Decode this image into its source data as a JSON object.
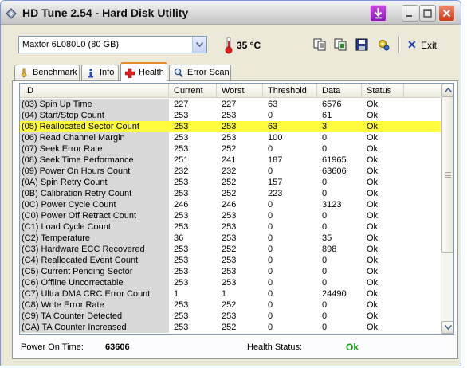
{
  "window": {
    "title": "HD Tune 2.54 - Hard Disk Utility",
    "icons": {
      "app": "hd-tune-icon",
      "download": "download-arrow-icon",
      "minimize": "minimize-icon",
      "maximize": "maximize-icon",
      "close": "close-icon"
    }
  },
  "toolbar": {
    "drive": "Maxtor 6L080L0 (80 GB)",
    "temperature": "35 °C",
    "exit_symbol": "✕",
    "exit_label": "Exit",
    "icons": [
      "copy-text-icon",
      "copy-screen-icon",
      "save-icon",
      "options-icon"
    ]
  },
  "tabs": [
    {
      "label": "Benchmark",
      "icon": "benchmark-icon",
      "active": false
    },
    {
      "label": "Info",
      "icon": "info-icon",
      "active": false
    },
    {
      "label": "Health",
      "icon": "health-cross-icon",
      "active": true
    },
    {
      "label": "Error Scan",
      "icon": "magnifier-icon",
      "active": false
    }
  ],
  "health": {
    "columns": [
      "ID",
      "Current",
      "Worst",
      "Threshold",
      "Data",
      "Status"
    ],
    "rows": [
      {
        "id": "(03) Spin Up Time",
        "current": "227",
        "worst": "227",
        "threshold": "63",
        "data": "6576",
        "status": "Ok",
        "highlight": false
      },
      {
        "id": "(04) Start/Stop Count",
        "current": "253",
        "worst": "253",
        "threshold": "0",
        "data": "61",
        "status": "Ok",
        "highlight": false
      },
      {
        "id": "(05) Reallocated Sector Count",
        "current": "253",
        "worst": "253",
        "threshold": "63",
        "data": "3",
        "status": "Ok",
        "highlight": true
      },
      {
        "id": "(06) Read Channel Margin",
        "current": "253",
        "worst": "253",
        "threshold": "100",
        "data": "0",
        "status": "Ok",
        "highlight": false
      },
      {
        "id": "(07) Seek Error Rate",
        "current": "253",
        "worst": "252",
        "threshold": "0",
        "data": "0",
        "status": "Ok",
        "highlight": false
      },
      {
        "id": "(08) Seek Time Performance",
        "current": "251",
        "worst": "241",
        "threshold": "187",
        "data": "61965",
        "status": "Ok",
        "highlight": false
      },
      {
        "id": "(09) Power On Hours Count",
        "current": "232",
        "worst": "232",
        "threshold": "0",
        "data": "63606",
        "status": "Ok",
        "highlight": false
      },
      {
        "id": "(0A) Spin Retry Count",
        "current": "253",
        "worst": "252",
        "threshold": "157",
        "data": "0",
        "status": "Ok",
        "highlight": false
      },
      {
        "id": "(0B) Calibration Retry Count",
        "current": "253",
        "worst": "252",
        "threshold": "223",
        "data": "0",
        "status": "Ok",
        "highlight": false
      },
      {
        "id": "(0C) Power Cycle Count",
        "current": "246",
        "worst": "246",
        "threshold": "0",
        "data": "3123",
        "status": "Ok",
        "highlight": false
      },
      {
        "id": "(C0) Power Off Retract Count",
        "current": "253",
        "worst": "253",
        "threshold": "0",
        "data": "0",
        "status": "Ok",
        "highlight": false
      },
      {
        "id": "(C1) Load Cycle Count",
        "current": "253",
        "worst": "253",
        "threshold": "0",
        "data": "0",
        "status": "Ok",
        "highlight": false
      },
      {
        "id": "(C2) Temperature",
        "current": "36",
        "worst": "253",
        "threshold": "0",
        "data": "35",
        "status": "Ok",
        "highlight": false
      },
      {
        "id": "(C3) Hardware ECC Recovered",
        "current": "253",
        "worst": "252",
        "threshold": "0",
        "data": "898",
        "status": "Ok",
        "highlight": false
      },
      {
        "id": "(C4) Reallocated Event Count",
        "current": "253",
        "worst": "253",
        "threshold": "0",
        "data": "0",
        "status": "Ok",
        "highlight": false
      },
      {
        "id": "(C5) Current Pending Sector",
        "current": "253",
        "worst": "253",
        "threshold": "0",
        "data": "0",
        "status": "Ok",
        "highlight": false
      },
      {
        "id": "(C6) Offline Uncorrectable",
        "current": "253",
        "worst": "253",
        "threshold": "0",
        "data": "0",
        "status": "Ok",
        "highlight": false
      },
      {
        "id": "(C7) Ultra DMA CRC Error Count",
        "current": "1",
        "worst": "1",
        "threshold": "0",
        "data": "24490",
        "status": "Ok",
        "highlight": false
      },
      {
        "id": "(C8) Write Error Rate",
        "current": "253",
        "worst": "252",
        "threshold": "0",
        "data": "0",
        "status": "Ok",
        "highlight": false
      },
      {
        "id": "(C9) TA Counter Detected",
        "current": "253",
        "worst": "253",
        "threshold": "0",
        "data": "0",
        "status": "Ok",
        "highlight": false
      },
      {
        "id": "(CA) TA Counter Increased",
        "current": "253",
        "worst": "252",
        "threshold": "0",
        "data": "0",
        "status": "Ok",
        "highlight": false
      }
    ]
  },
  "footer": {
    "power_on_label": "Power On Time:",
    "power_on_value": "63606",
    "health_label": "Health Status:",
    "health_value": "Ok",
    "health_color": "#10a010"
  },
  "colors": {
    "highlight_row": "#fffb3d",
    "active_tab_accent": "#e68b2c"
  }
}
